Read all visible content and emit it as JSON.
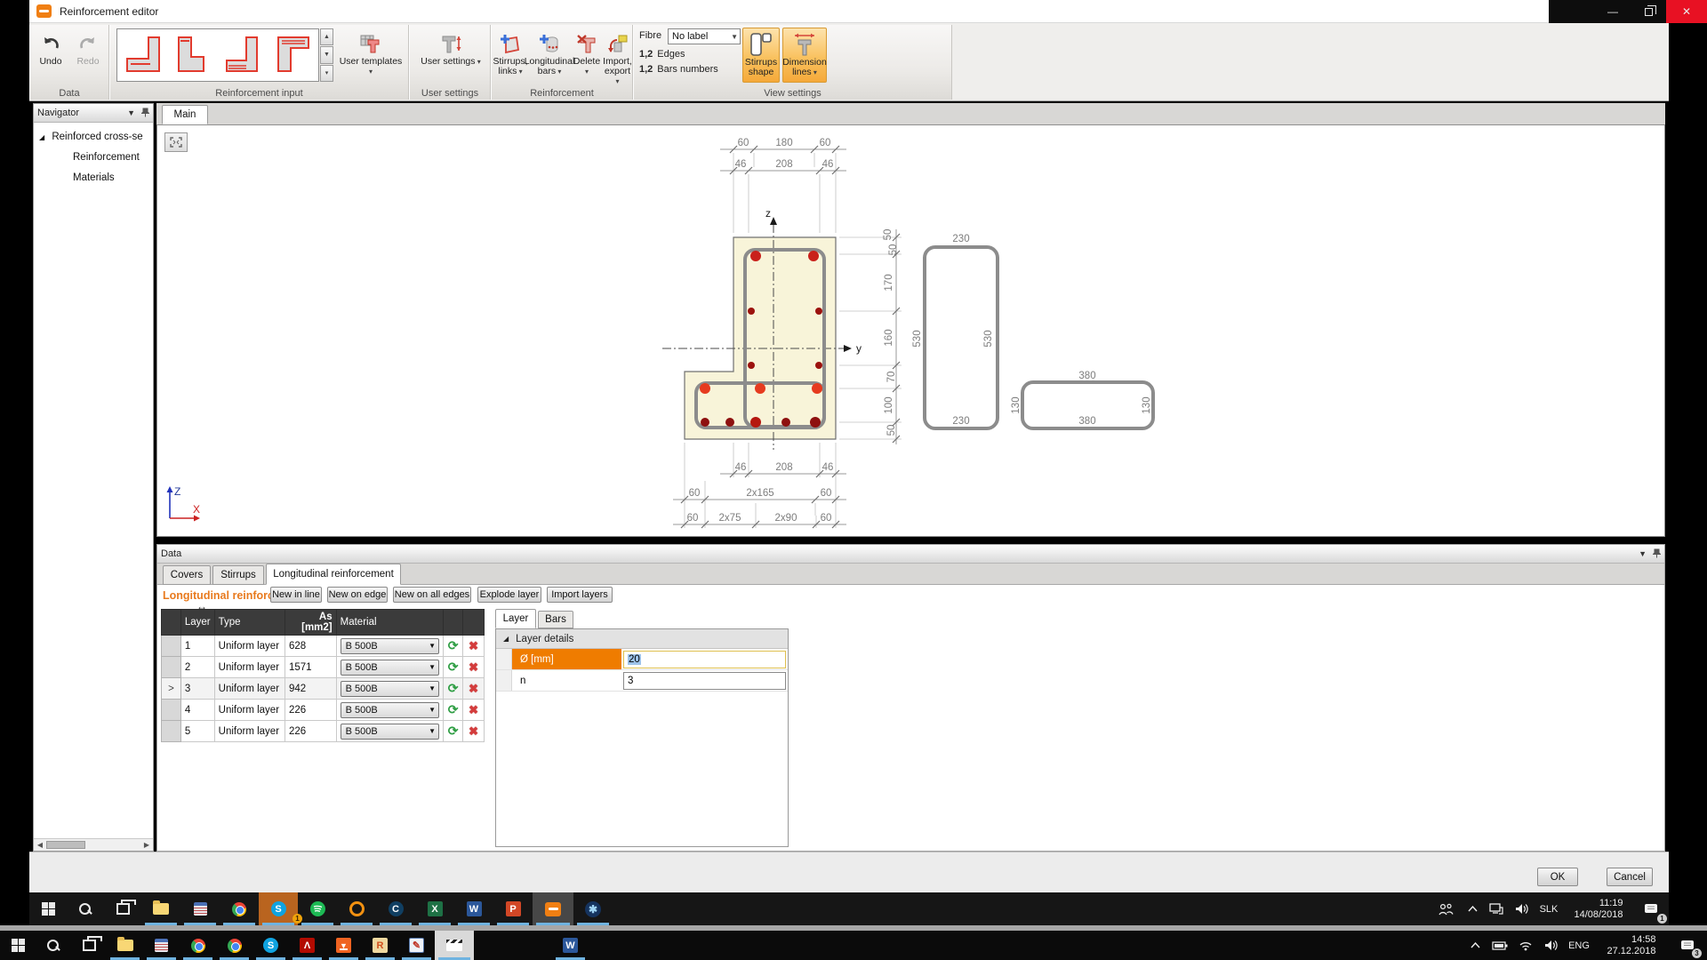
{
  "window": {
    "title": "Reinforcement editor"
  },
  "ribbon": {
    "groups": {
      "data": "Data",
      "input": "Reinforcement input",
      "user": "User settings",
      "reinforcement": "Reinforcement",
      "view": "View settings"
    },
    "undo": "Undo",
    "redo": "Redo",
    "user_templates": "User templates",
    "user_settings": "User settings",
    "stirrups_links": "Stirrups, links",
    "longitudinal_bars": "Longitudinal bars",
    "delete": "Delete",
    "import_export": "Import, export",
    "fibre_label": "Fibre",
    "fibre_value": "No label",
    "edges_prefix": "1,2",
    "edges_label": "Edges",
    "bars_prefix": "1,2",
    "bars_label": "Bars numbers",
    "stirrups_shape": "Stirrups shape",
    "dimension_lines": "Dimension lines",
    "accent_selected": "#f5a93a"
  },
  "navigator": {
    "title": "Navigator",
    "items": [
      "Reinforced cross-se",
      "Reinforcement",
      "Materials"
    ]
  },
  "main_tab": "Main",
  "drawing": {
    "axis_z": "z",
    "axis_y": "y",
    "origin": {
      "z": "Z",
      "x": "X"
    },
    "section_fill": "#f8f4d9",
    "stirrup_color": "#8c8c8c",
    "bar_red": "#c9211b",
    "bar_dark": "#9c120e",
    "bar_bright": "#e63b1f",
    "dim_top_row1": [
      "60",
      "180",
      "60"
    ],
    "dim_top_row2": [
      "46",
      "208",
      "46"
    ],
    "dim_bottom_row1": [
      "46",
      "208",
      "46"
    ],
    "dim_bottom_row2": [
      "60",
      "2x165",
      "60"
    ],
    "dim_bottom_row3": [
      "60",
      "2x75",
      "2x90",
      "60"
    ],
    "dim_right_chain": [
      "50",
      "50",
      "170",
      "160",
      "70",
      "100",
      "50"
    ],
    "stirrup_tall": {
      "width": "230",
      "height": "530"
    },
    "stirrup_wide": {
      "width": "380",
      "height": "130"
    }
  },
  "datapanel": {
    "title": "Data",
    "tabs": [
      "Covers",
      "Stirrups",
      "Longitudinal reinforcement"
    ],
    "heading": "Longitudinal reinforcement",
    "buttons": [
      "New in line",
      "New on edge",
      "New on all edges",
      "Explode layer",
      "Import layers"
    ],
    "table": {
      "headers": [
        "Layer",
        "Type",
        "As [mm2]",
        "Material"
      ],
      "selected_marker": ">",
      "rows": [
        {
          "layer": "1",
          "type": "Uniform layer",
          "as": "628",
          "material": "B 500B"
        },
        {
          "layer": "2",
          "type": "Uniform layer",
          "as": "1571",
          "material": "B 500B"
        },
        {
          "layer": "3",
          "type": "Uniform layer",
          "as": "942",
          "material": "B 500B"
        },
        {
          "layer": "4",
          "type": "Uniform layer",
          "as": "226",
          "material": "B 500B"
        },
        {
          "layer": "5",
          "type": "Uniform layer",
          "as": "226",
          "material": "B 500B"
        }
      ]
    },
    "subpanel": {
      "tabs": [
        "Layer",
        "Bars"
      ],
      "group": "Layer details",
      "diameter_label": "Ø [mm]",
      "diameter_value": "20",
      "n_label": "n",
      "n_value": "3",
      "diameter_row_color": "#ef7c00"
    }
  },
  "footer": {
    "ok": "OK",
    "cancel": "Cancel"
  },
  "taskbar_top": {
    "lang": "SLK",
    "time": "11:19",
    "date": "14/08/2018",
    "notif_badge": "1",
    "skype_badge": "1"
  },
  "taskbar_bottom": {
    "lang": "ENG",
    "time": "14:58",
    "date": "27.12.2018",
    "notif_badge": "3"
  }
}
